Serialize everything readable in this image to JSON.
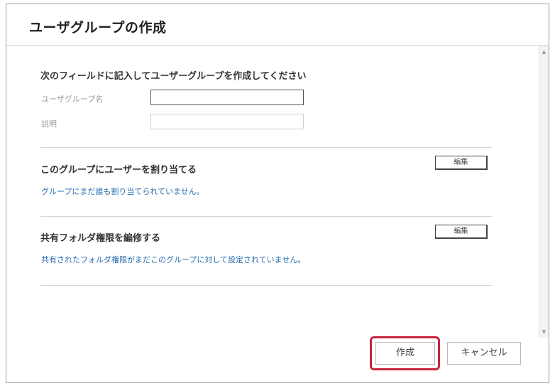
{
  "dialog": {
    "title": "ユーザグループの作成"
  },
  "form": {
    "intro": "次のフィールドに記入してユーザーグループを作成してください",
    "group_name_label": "ユーザグループ名",
    "group_name_value": "",
    "description_label": "説明",
    "description_value": ""
  },
  "assign_section": {
    "title": "このグループにユーザーを割り当てる",
    "edit_label": "編集",
    "status_link": "グループにまだ誰も割り当てられていません。"
  },
  "folder_section": {
    "title": "共有フォルダ権限を編修する",
    "edit_label": "編集",
    "status_link": "共有されたフォルダ権限がまだこのグループに対して設定されていません。"
  },
  "footer": {
    "create_label": "作成",
    "cancel_label": "キャンセル"
  },
  "scrollbar": {
    "up_icon": "scroll-up-arrow",
    "down_icon": "scroll-down-arrow"
  },
  "colors": {
    "highlight": "#c8243d",
    "link": "#2a6fb0"
  }
}
